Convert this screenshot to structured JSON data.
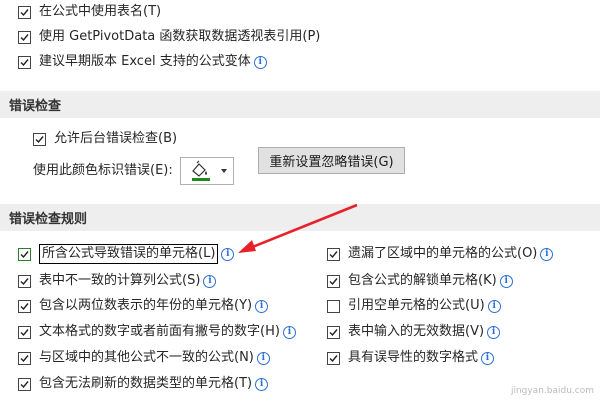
{
  "top_options": [
    {
      "label": "在公式中使用表名(T)",
      "checked": true,
      "info": false
    },
    {
      "label": "使用 GetPivotData 函数获取数据透视表引用(P)",
      "checked": true,
      "info": false
    },
    {
      "label": "建议早期版本 Excel 支持的公式变体",
      "checked": true,
      "info": true
    }
  ],
  "error_checking": {
    "title": "错误检查",
    "enable_background_label": "允许后台错误检查(B)",
    "enable_background_checked": true,
    "color_label": "使用此颜色标识错误(E):",
    "color_value": "#1a8c1a",
    "reset_button_label": "重新设置忽略错误(G)"
  },
  "rules": {
    "title": "错误检查规则",
    "left": [
      {
        "label": "所含公式导致错误的单元格(L)",
        "checked": true,
        "info": true
      },
      {
        "label": "表中不一致的计算列公式(S)",
        "checked": true,
        "info": true
      },
      {
        "label": "包含以两位数表示的年份的单元格(Y)",
        "checked": true,
        "info": true
      },
      {
        "label": "文本格式的数字或者前面有撇号的数字(H)",
        "checked": true,
        "info": true
      },
      {
        "label": "与区域中的其他公式不一致的公式(N)",
        "checked": true,
        "info": true
      },
      {
        "label": "包含无法刷新的数据类型的单元格(T)",
        "checked": true,
        "info": true
      }
    ],
    "right": [
      {
        "label": "遗漏了区域中的单元格的公式(O)",
        "checked": true,
        "info": true
      },
      {
        "label": "包含公式的解锁单元格(K)",
        "checked": true,
        "info": true
      },
      {
        "label": "引用空单元格的公式(U)",
        "checked": false,
        "info": true
      },
      {
        "label": "表中输入的无效数据(V)",
        "checked": true,
        "info": true
      },
      {
        "label": "具有误导性的数字格式",
        "checked": true,
        "info": true
      }
    ]
  },
  "watermark": "jingyan.baidu.com"
}
